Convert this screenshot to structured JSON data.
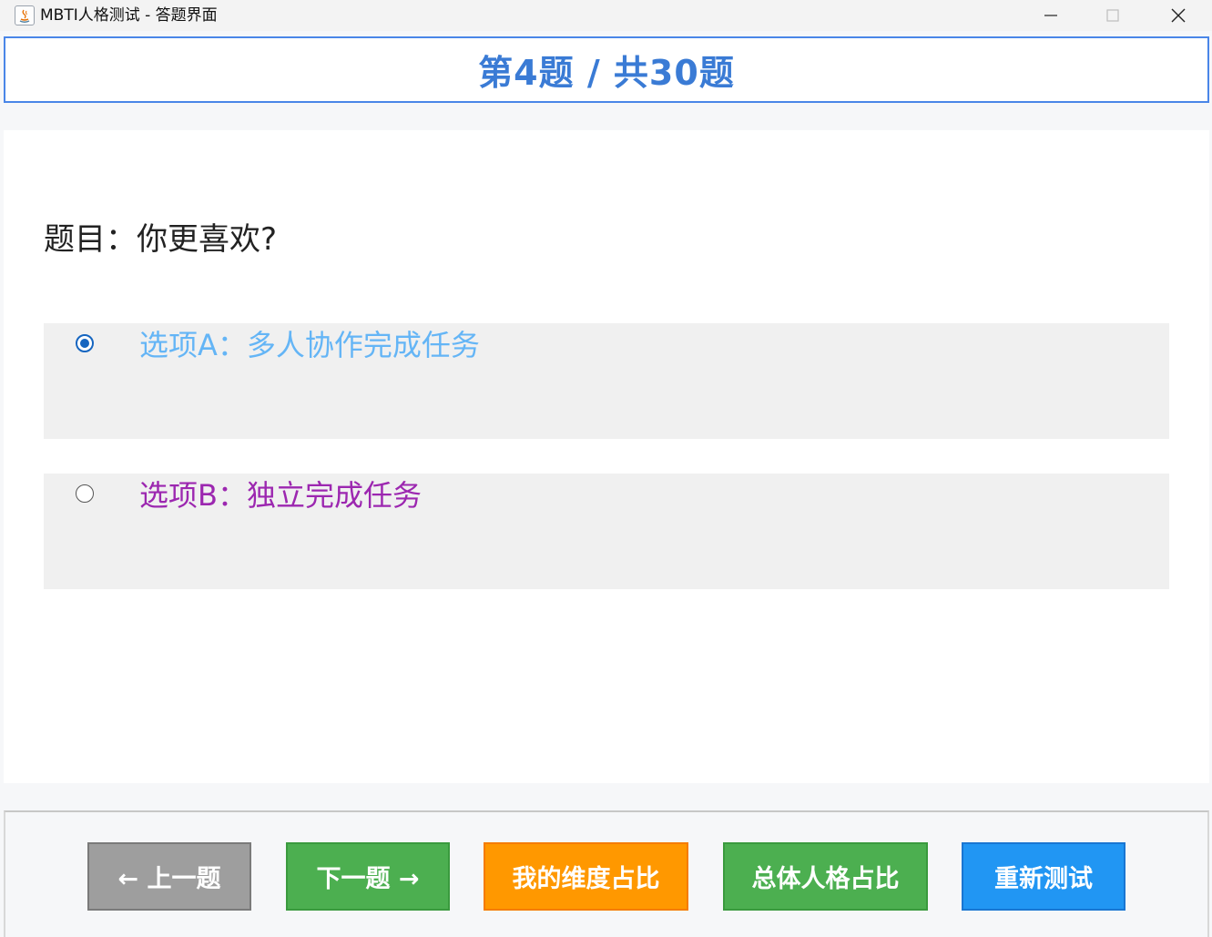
{
  "window": {
    "title": "MBTI人格测试 - 答题界面"
  },
  "header": {
    "progress_title": "第4题 / 共30题"
  },
  "question": {
    "text": "题目：你更喜欢?"
  },
  "options": [
    {
      "label": "选项A：多人协作完成任务",
      "selected": true
    },
    {
      "label": "选项B：独立完成任务",
      "selected": false
    }
  ],
  "footer": {
    "prev_label": "← 上一题",
    "next_label": "下一题 →",
    "dimension_label": "我的维度占比",
    "overall_label": "总体人格占比",
    "reset_label": "重新测试"
  },
  "colors": {
    "header_accent": "#3a7bd5",
    "option_a_text": "#64b5f6",
    "option_b_text": "#9c27b0",
    "prev_button": "#9e9e9e",
    "next_button": "#4caf50",
    "dimension_button": "#ff9800",
    "overall_button": "#4caf50",
    "reset_button": "#2196f3"
  },
  "icons": {
    "app": "java-app-icon",
    "minimize": "minimize-icon",
    "maximize": "maximize-icon",
    "close": "close-icon"
  }
}
